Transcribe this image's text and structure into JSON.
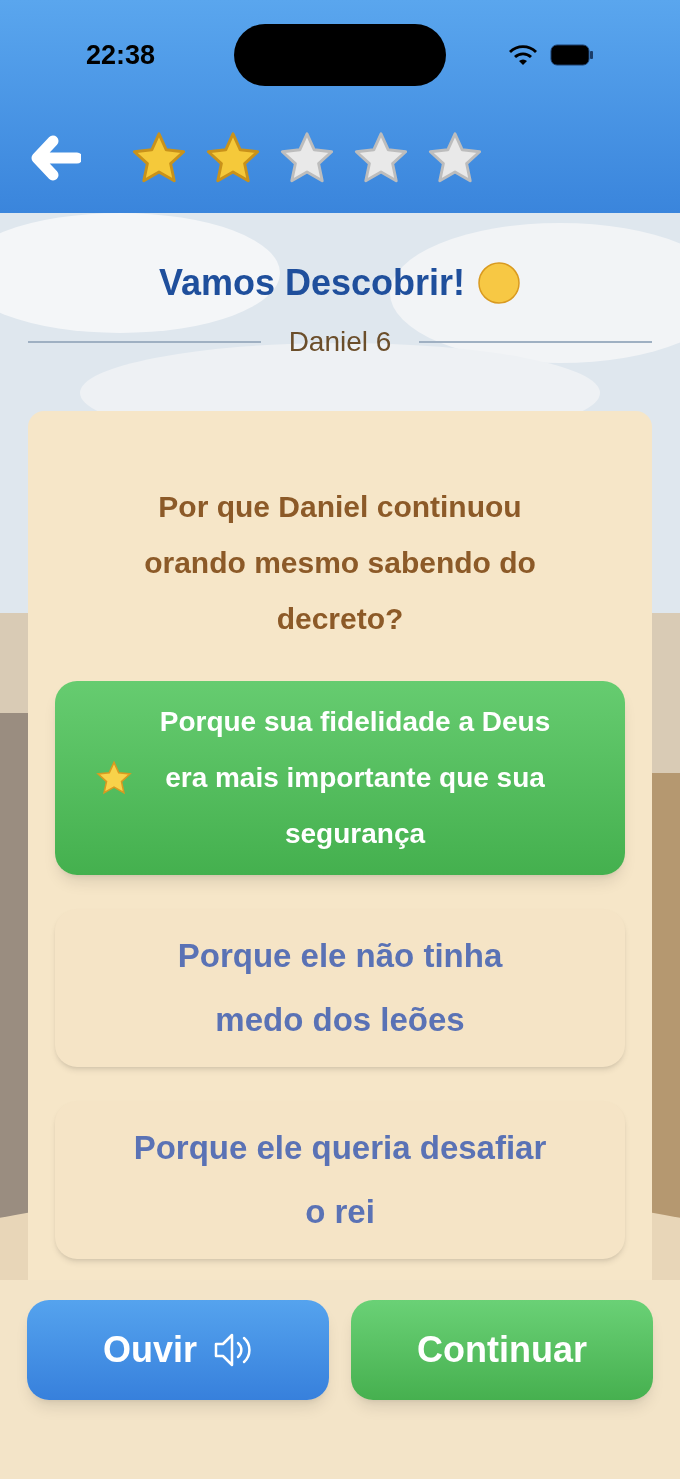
{
  "status_bar": {
    "time": "22:38"
  },
  "header": {
    "stars": 2
  },
  "title": "Vamos Descobrir!",
  "reference": "Daniel 6",
  "question": "Por que Daniel continuou orando mesmo sabendo do decreto?",
  "answers": [
    {
      "text": "Porque sua fidelidade a Deus era mais importante que sua segurança",
      "selected": true
    },
    {
      "text": "Porque ele não tinha medo dos leões",
      "selected": false
    },
    {
      "text": "Porque ele queria desafiar o rei",
      "selected": false
    }
  ],
  "buttons": [
    {
      "kind": "listen",
      "label": "Ouvir"
    },
    {
      "kind": "continue",
      "label": "Continuar"
    }
  ]
}
